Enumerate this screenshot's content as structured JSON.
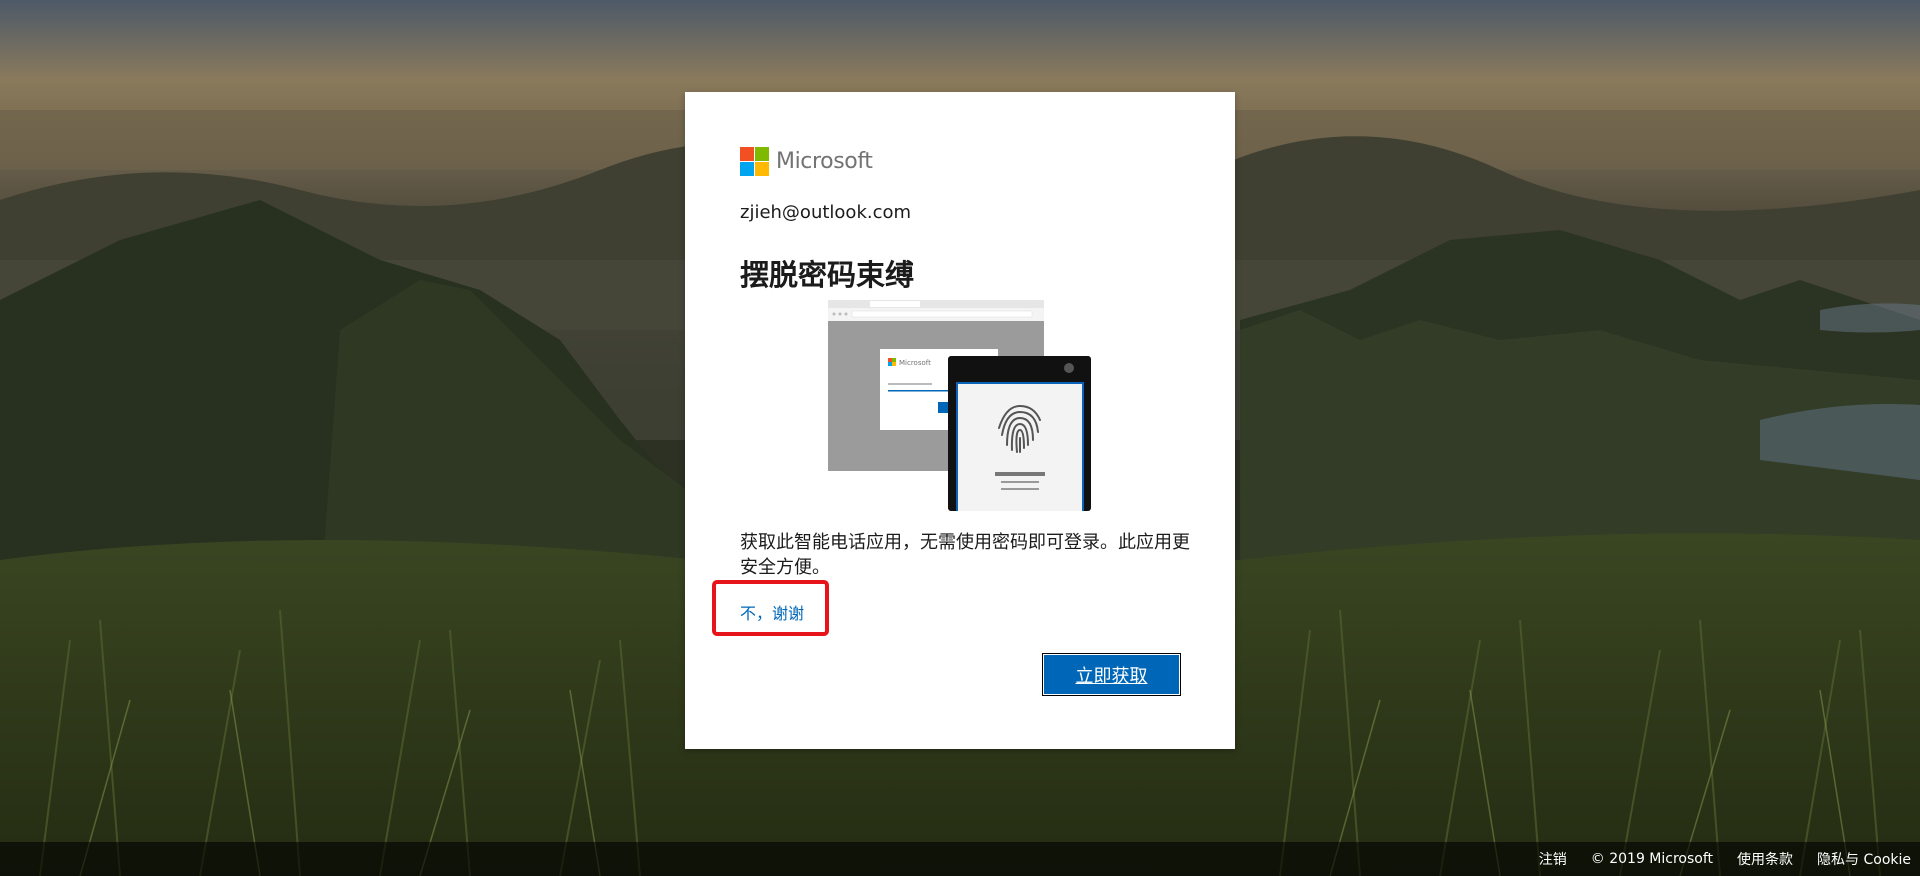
{
  "brand": {
    "name": "Microsoft",
    "logo_colors": [
      "#f25022",
      "#7fba00",
      "#00a4ef",
      "#ffb900"
    ],
    "accent": "#0067b8"
  },
  "card": {
    "email": "zjieh@outlook.com",
    "title": "摆脱密码束缚",
    "description": "获取此智能电话应用，无需使用密码即可登录。此应用更安全方便。",
    "no_thanks_label": "不，谢谢",
    "get_now_label": "立即获取",
    "illustration": {
      "desktop_logo_text": "Microsoft",
      "phone_icon": "fingerprint-icon"
    }
  },
  "footer": {
    "items": [
      "注销",
      "© 2019 Microsoft",
      "使用条款",
      "隐私与 Cookie"
    ]
  },
  "annotation": {
    "highlight_color": "#e8141b"
  }
}
